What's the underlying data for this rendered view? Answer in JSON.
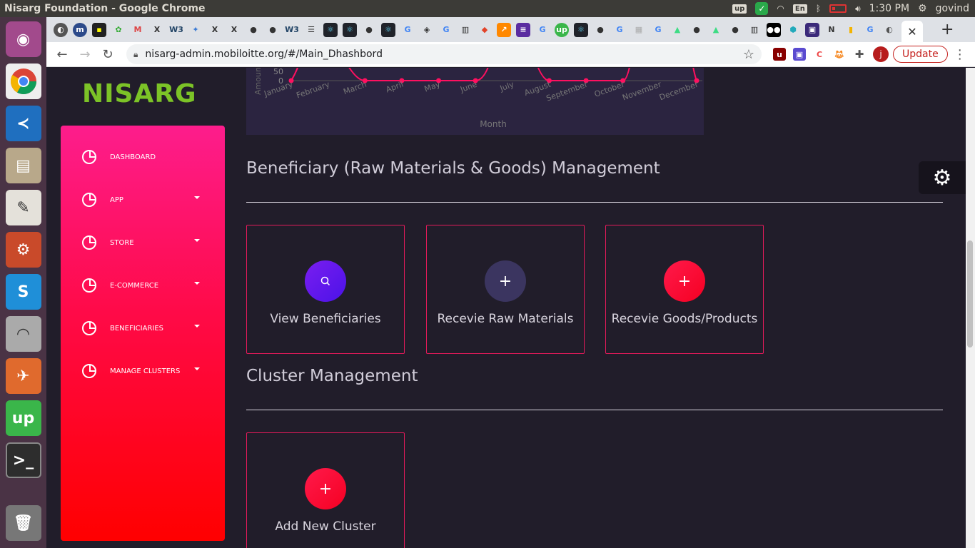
{
  "os": {
    "window_title": "Nisarg Foundation - Google Chrome",
    "lang": "En",
    "time": "1:30 PM",
    "user": "govind"
  },
  "browser": {
    "url": "nisarg-admin.mobiloitte.org/#/Main_Dhashbord",
    "update_label": "Update",
    "avatar_letter": "j"
  },
  "app": {
    "logo": "NISARG",
    "nav": [
      {
        "label": "DASHBOARD"
      },
      {
        "label": "APP"
      },
      {
        "label": "STORE"
      },
      {
        "label": "E-COMMERCE"
      },
      {
        "label": "BENEFICIARIES"
      },
      {
        "label": "MANAGE CLUSTERS"
      }
    ],
    "sections": {
      "beneficiary": {
        "title": "Beneficiary (Raw Materials & Goods) Management",
        "cards": [
          {
            "label": "View Beneficiaries",
            "icon": "search-icon"
          },
          {
            "label": "Recevie Raw Materials",
            "icon": "plus-icon"
          },
          {
            "label": "Recevie Goods/Products",
            "icon": "plus-icon"
          }
        ]
      },
      "cluster": {
        "title": "Cluster Management",
        "cards": [
          {
            "label": "Add New Cluster",
            "icon": "plus-icon"
          }
        ]
      }
    },
    "colors": {
      "accent": "#ff0a48",
      "brand_green": "#7cc327",
      "background": "#211d2a"
    }
  },
  "chart_data": {
    "type": "line",
    "categories": [
      "January",
      "February",
      "March",
      "April",
      "May",
      "June",
      "July",
      "August",
      "September",
      "October",
      "November",
      "December"
    ],
    "values": [
      0,
      null,
      0,
      0,
      0,
      0,
      null,
      0,
      0,
      0,
      null,
      0
    ],
    "xlabel": "Month",
    "ylabel": "Amount",
    "yticks": [
      "50",
      "0"
    ]
  }
}
